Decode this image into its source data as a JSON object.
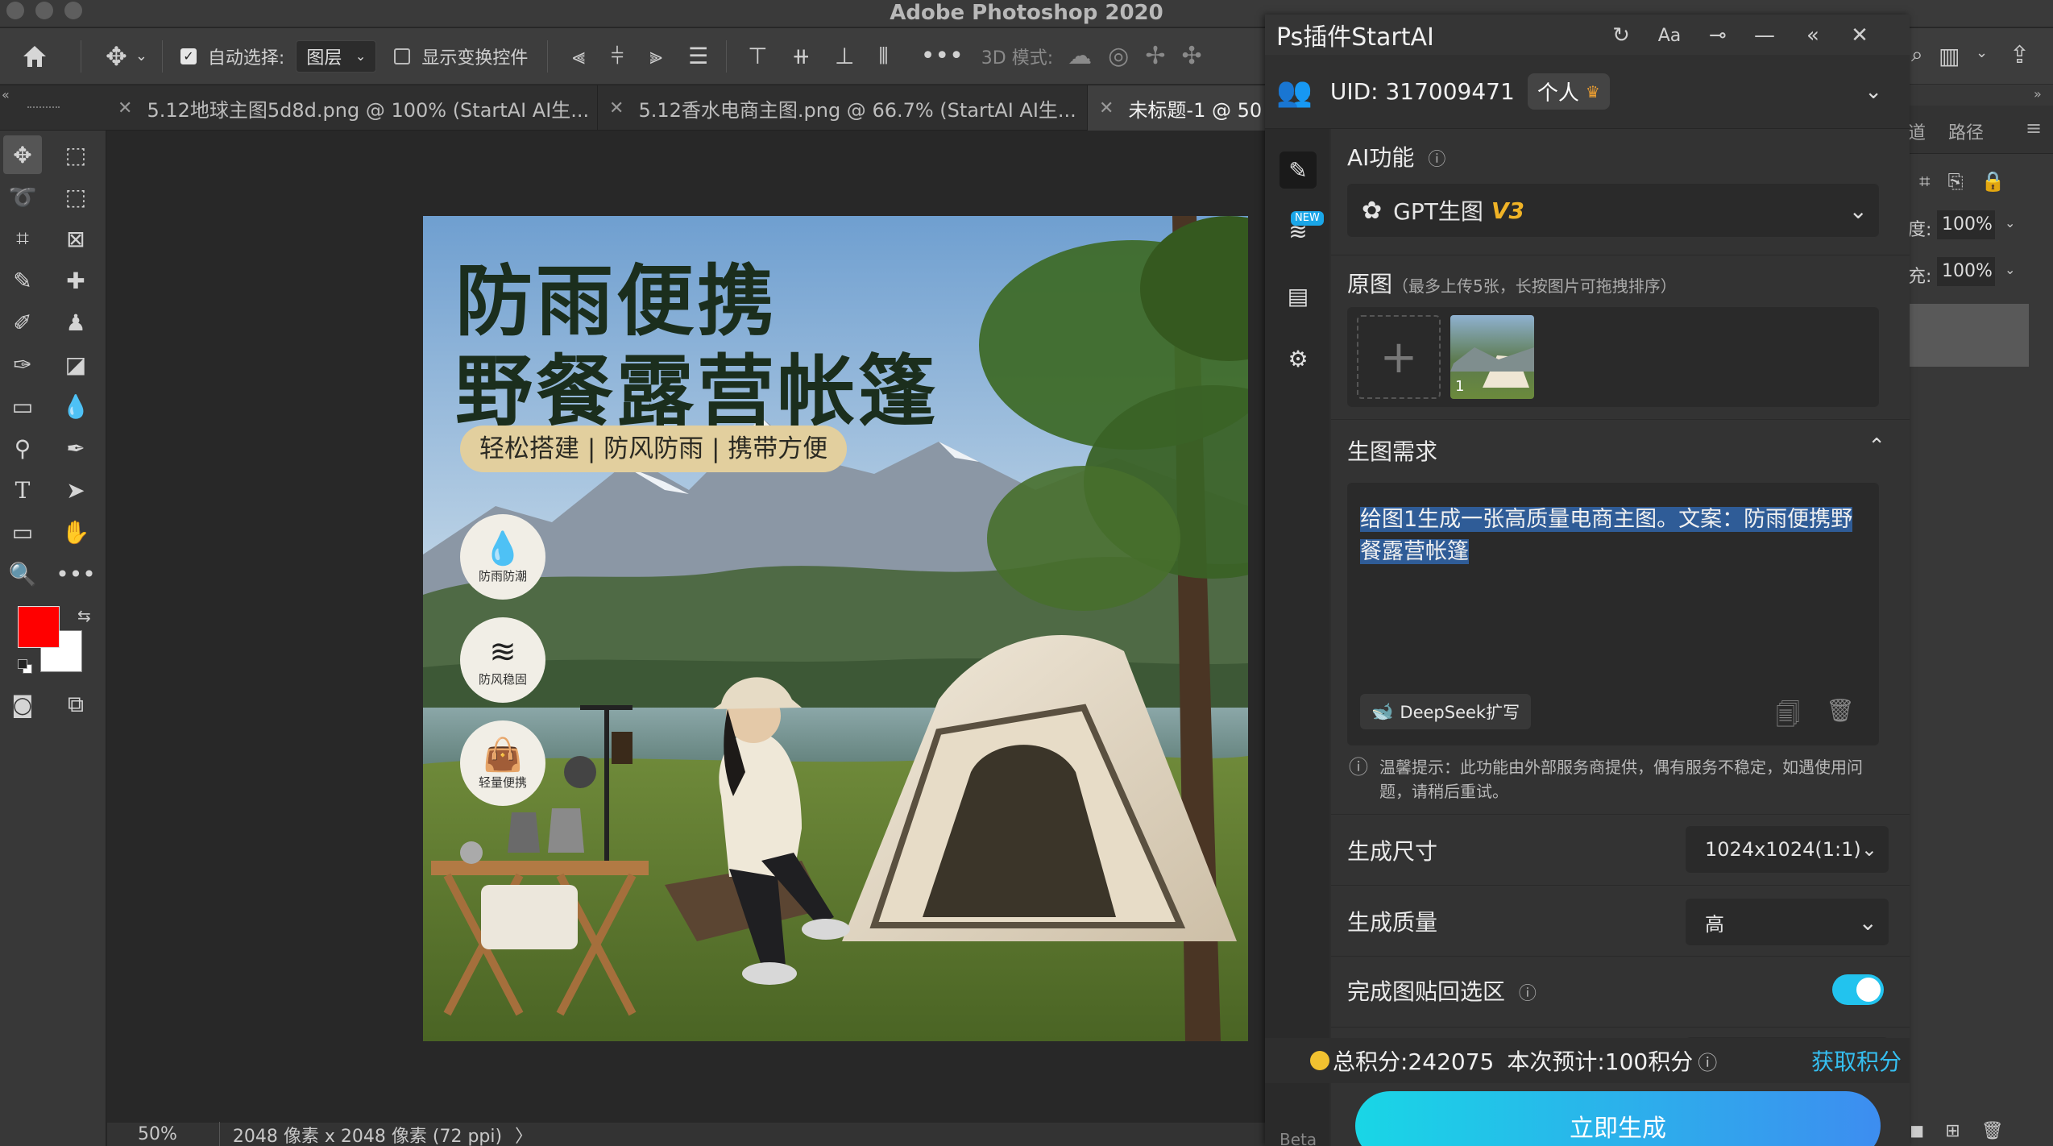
{
  "window": {
    "title": "Adobe Photoshop 2020"
  },
  "options_bar": {
    "auto_select_label": "自动选择:",
    "auto_select_value": "图层",
    "show_transform_label": "显示变换控件",
    "mode_3d_label": "3D 模式:"
  },
  "tabs": [
    {
      "label": "5.12地球主图5d8d.png @ 100% (StartAI AI生..."
    },
    {
      "label": "5.12香水电商主图.png @ 66.7% (StartAI AI生..."
    },
    {
      "label": "未标题-1 @ 50"
    }
  ],
  "status": {
    "zoom": "50%",
    "doc_info": "2048 像素 x 2048 像素 (72 ppi)",
    "arrow": "〉"
  },
  "artwork": {
    "headline_1": "防雨便携",
    "headline_2": "野餐露营帐篷",
    "tagline": "轻松搭建 | 防风防雨 | 携带方便",
    "badges": [
      "防雨防潮",
      "防风稳固",
      "轻量便携"
    ]
  },
  "plugin": {
    "title": "Ps插件StartAI",
    "uid_label": "UID: 317009471",
    "account_type": "个人",
    "ai_feature_label": "AI功能",
    "ai_feature_value": "GPT生图",
    "ai_feature_version": "V3",
    "new_badge": "NEW",
    "source_label": "原图",
    "source_hint": "（最多上传5张，长按图片可拖拽排序）",
    "thumb_index": "1",
    "prompt_label": "生图需求",
    "prompt_text": "给图1生成一张高质量电商主图。文案：防雨便携野餐露营帐篷",
    "deepseek_label": "DeepSeek扩写",
    "notice": "温馨提示：此功能由外部服务商提供，偶有服务不稳定，如遇使用问题，请稍后重试。",
    "size_label": "生成尺寸",
    "size_value": "1024x1024(1:1)",
    "quality_label": "生成质量",
    "quality_value": "高",
    "paste_back_label": "完成图贴回选区",
    "paste_back_on": true,
    "points_total": "总积分:242075",
    "points_estimate": "本次预计:100积分",
    "get_points": "获取积分",
    "generate_label": "立即生成",
    "beta_label": "Beta"
  },
  "right_panel": {
    "tab_channels": "道",
    "tab_paths": "路径",
    "opacity_label": "度:",
    "opacity_value": "100%",
    "fill_label": "充:",
    "fill_value": "100%"
  },
  "colors": {
    "foreground": "#ff0000",
    "background": "#ffffff",
    "accent": "#22c3ee"
  }
}
